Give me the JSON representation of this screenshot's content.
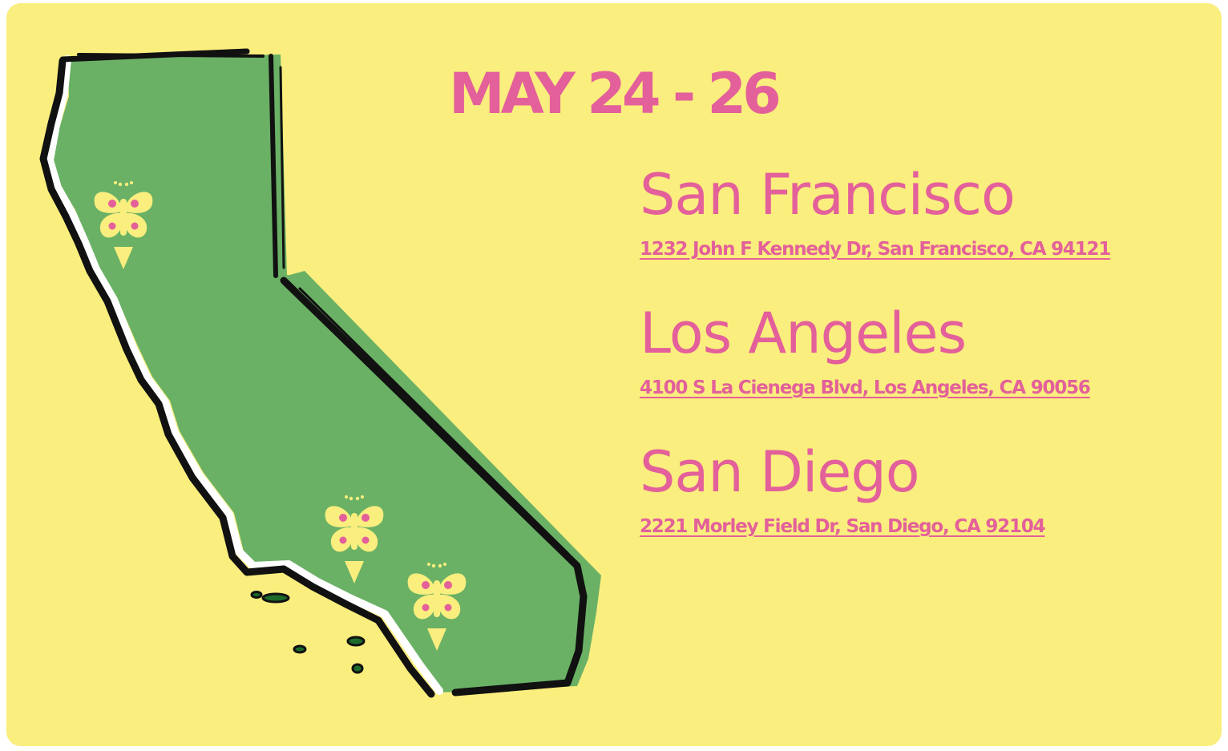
{
  "event": {
    "dates": "MAY 24 - 26"
  },
  "locations": [
    {
      "city": "San Francisco",
      "address": "1232 John F Kennedy Dr, San Francisco, CA 94121"
    },
    {
      "city": "Los Angeles",
      "address": "4100 S La Cienega Blvd, Los Angeles, CA 90056"
    },
    {
      "city": "San Diego",
      "address": "2221 Morley Field Dr, San Diego, CA 92104"
    }
  ],
  "colors": {
    "background": "#faee7e",
    "accent_pink": "#e3609a",
    "map_green": "#6ab165",
    "outline_black": "#111111"
  },
  "icons": {
    "map": "california-map-icon",
    "marker": "butterfly-location-marker-icon"
  }
}
